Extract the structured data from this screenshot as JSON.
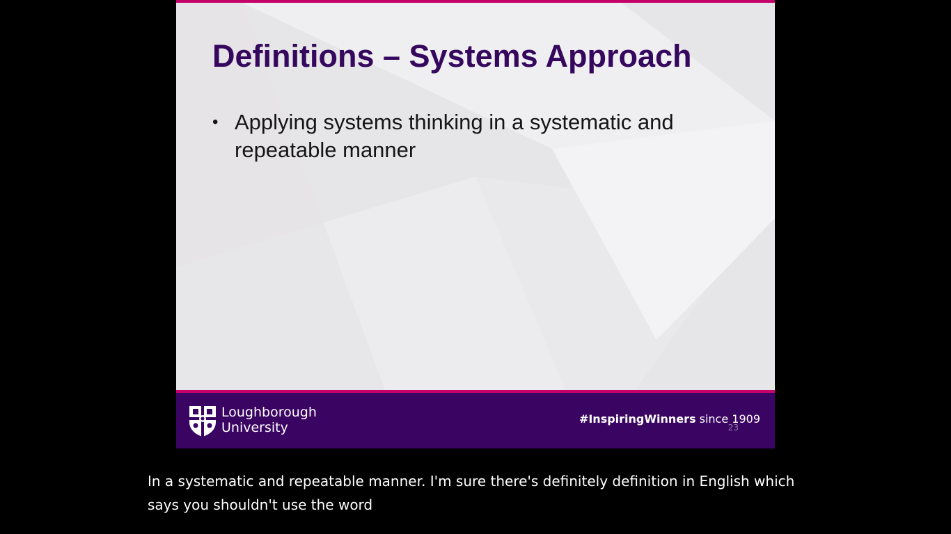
{
  "slide": {
    "title": "Definitions – Systems Approach",
    "bullets": [
      "Applying systems thinking in a systematic and repeatable manner"
    ],
    "bullet_glyph": "•",
    "footer": {
      "university_line1": "Loughborough",
      "university_line2": "University",
      "hashtag": "#InspiringWinners",
      "since_text": " since 1909",
      "slide_number": "23"
    }
  },
  "captions": {
    "text": "In a systematic and repeatable manner. I'm sure there's definitely definition in English which says you shouldn't use the word"
  },
  "colors": {
    "accent_pink": "#c4006b",
    "brand_purple": "#3a0462",
    "title_purple": "#35085e",
    "slide_background": "#e6e5e8",
    "viewer_background": "#000000"
  },
  "icons": {
    "logo": "university-crest-icon"
  }
}
